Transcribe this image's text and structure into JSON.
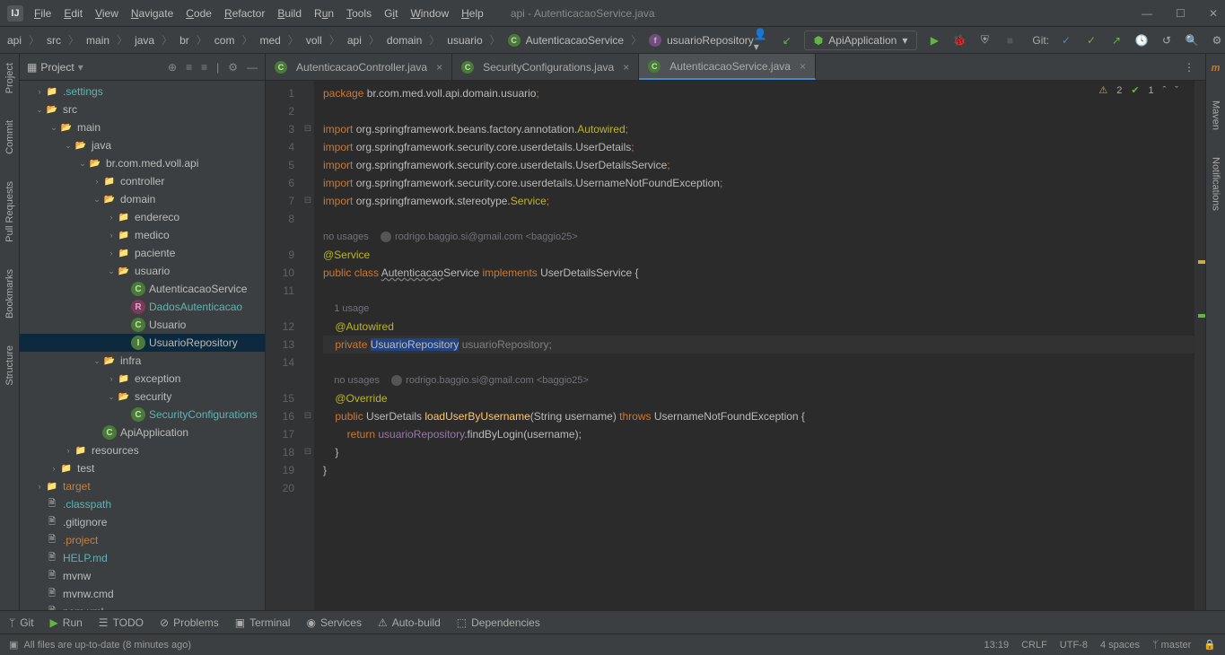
{
  "window": {
    "title": "api - AutenticacaoService.java"
  },
  "menus": [
    "File",
    "Edit",
    "View",
    "Navigate",
    "Code",
    "Refactor",
    "Build",
    "Run",
    "Tools",
    "Git",
    "Window",
    "Help"
  ],
  "breadcrumb": [
    "api",
    "src",
    "main",
    "java",
    "br",
    "com",
    "med",
    "voll",
    "api",
    "domain",
    "usuario"
  ],
  "breadcrumb_class": "AutenticacaoService",
  "breadcrumb_field": "usuarioRepository",
  "runconfig": "ApiApplication",
  "git_label": "Git:",
  "left_tools": [
    "Project",
    "Commit",
    "Pull Requests",
    "Bookmarks",
    "Structure"
  ],
  "right_tools": [
    "Maven",
    "Notifications"
  ],
  "project_title": "Project",
  "tree": [
    {
      "d": 1,
      "caret": ">",
      "icon": "folder",
      "label": ".settings",
      "cls": "txt-teal"
    },
    {
      "d": 1,
      "caret": "v",
      "icon": "folder-open",
      "label": "src"
    },
    {
      "d": 2,
      "caret": "v",
      "icon": "folder-open",
      "label": "main"
    },
    {
      "d": 3,
      "caret": "v",
      "icon": "src-root",
      "label": "java"
    },
    {
      "d": 4,
      "caret": "v",
      "icon": "folder-open",
      "label": "br.com.med.voll.api"
    },
    {
      "d": 5,
      "caret": ">",
      "icon": "folder",
      "label": "controller"
    },
    {
      "d": 5,
      "caret": "v",
      "icon": "folder-open",
      "label": "domain"
    },
    {
      "d": 6,
      "caret": ">",
      "icon": "folder",
      "label": "endereco"
    },
    {
      "d": 6,
      "caret": ">",
      "icon": "folder",
      "label": "medico"
    },
    {
      "d": 6,
      "caret": ">",
      "icon": "folder",
      "label": "paciente"
    },
    {
      "d": 6,
      "caret": "v",
      "icon": "folder-open",
      "label": "usuario"
    },
    {
      "d": 7,
      "caret": "",
      "icon": "cls",
      "label": "AutenticacaoService"
    },
    {
      "d": 7,
      "caret": "",
      "icon": "rec",
      "label": "DadosAutenticacao",
      "cls": "txt-teal"
    },
    {
      "d": 7,
      "caret": "",
      "icon": "cls",
      "label": "Usuario"
    },
    {
      "d": 7,
      "caret": "",
      "icon": "intf",
      "label": "UsuarioRepository",
      "sel": true
    },
    {
      "d": 5,
      "caret": "v",
      "icon": "folder-open",
      "label": "infra"
    },
    {
      "d": 6,
      "caret": ">",
      "icon": "folder",
      "label": "exception"
    },
    {
      "d": 6,
      "caret": "v",
      "icon": "folder-open",
      "label": "security"
    },
    {
      "d": 7,
      "caret": "",
      "icon": "cls",
      "label": "SecurityConfigurations",
      "cls": "txt-teal"
    },
    {
      "d": 5,
      "caret": "",
      "icon": "cls",
      "label": "ApiApplication"
    },
    {
      "d": 3,
      "caret": ">",
      "icon": "folder",
      "label": "resources"
    },
    {
      "d": 2,
      "caret": ">",
      "icon": "folder",
      "label": "test"
    },
    {
      "d": 1,
      "caret": ">",
      "icon": "excl",
      "label": "target",
      "cls": "txt-orange"
    },
    {
      "d": 1,
      "caret": "",
      "icon": "file",
      "label": ".classpath",
      "cls": "txt-teal"
    },
    {
      "d": 1,
      "caret": "",
      "icon": "file",
      "label": ".gitignore"
    },
    {
      "d": 1,
      "caret": "",
      "icon": "file",
      "label": ".project",
      "cls": "txt-orange"
    },
    {
      "d": 1,
      "caret": "",
      "icon": "file",
      "label": "HELP.md",
      "cls": "txt-teal"
    },
    {
      "d": 1,
      "caret": "",
      "icon": "file",
      "label": "mvnw"
    },
    {
      "d": 1,
      "caret": "",
      "icon": "file",
      "label": "mvnw.cmd"
    },
    {
      "d": 1,
      "caret": "",
      "icon": "file",
      "label": "pom.xml"
    }
  ],
  "tabs": [
    {
      "label": "AutenticacaoController.java",
      "active": false
    },
    {
      "label": "SecurityConfigurations.java",
      "active": false
    },
    {
      "label": "AutenticacaoService.java",
      "active": true
    }
  ],
  "inspections": {
    "warn": "2",
    "ok": "1"
  },
  "lines": [
    "1",
    "2",
    "3",
    "4",
    "5",
    "6",
    "7",
    "8",
    "9",
    "10",
    "11",
    "12",
    "13",
    "14",
    "15",
    "16",
    "17",
    "18",
    "19",
    "20"
  ],
  "hints": {
    "class_usage": "no usages",
    "author": "rodrigo.baggio.si@gmail.com <baggio25>",
    "field_usage": "1 usage",
    "method_usage": "no usages"
  },
  "code": {
    "l1a": "package ",
    "l1b": "br.com.med.voll.api.domain.usuario",
    "l3a": "import ",
    "l3b": "org.springframework.beans.factory.annotation.",
    "l3c": "Autowired",
    "l4a": "import ",
    "l4b": "org.springframework.security.core.userdetails.UserDetails",
    "l5a": "import ",
    "l5b": "org.springframework.security.core.userdetails.UserDetailsService",
    "l6a": "import ",
    "l6b": "org.springframework.security.core.userdetails.UsernameNotFoundException",
    "l7a": "import ",
    "l7b": "org.springframework.stereotype.",
    "l7c": "Service",
    "l9": "@Service",
    "l10a": "public class ",
    "l10b": "Autenticacao",
    "l10c": "Service",
    "l10d": " implements ",
    "l10e": "UserDetailsService {",
    "l12": "@Autowired",
    "l13a": "private ",
    "l13b": "UsuarioRepository",
    "l13c": " usuarioRepository",
    "l15": "@Override",
    "l16a": "public ",
    "l16b": "UserDetails ",
    "l16c": "loadUserByUsername",
    "l16d": "(String username) ",
    "l16e": "throws ",
    "l16f": "UsernameNotFoundException {",
    "l17a": "return ",
    "l17b": "usuarioRepository",
    "l17c": ".findByLogin(username);",
    "l18": "}",
    "l19": "}"
  },
  "bottom_tabs": [
    "Git",
    "Run",
    "TODO",
    "Problems",
    "Terminal",
    "Services",
    "Auto-build",
    "Dependencies"
  ],
  "status": {
    "msg": "All files are up-to-date (8 minutes ago)",
    "pos": "13:19",
    "eol": "CRLF",
    "enc": "UTF-8",
    "indent": "4 spaces",
    "branch": "master"
  }
}
